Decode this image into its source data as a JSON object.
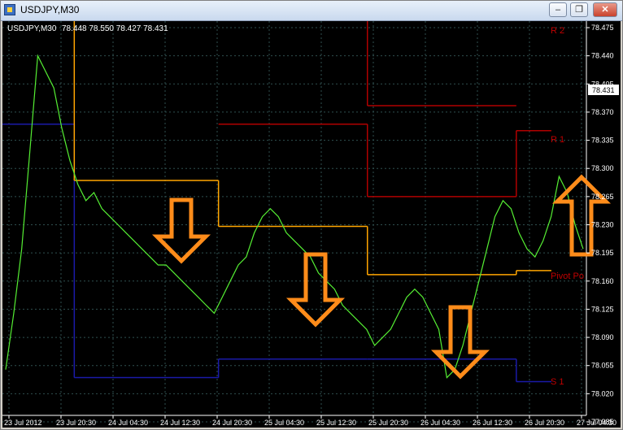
{
  "window": {
    "title": "USDJPY,M30",
    "minimize_label": "–",
    "restore_label": "❐",
    "close_label": "✕"
  },
  "chart_header": {
    "symbol_tf": "USDJPY,M30",
    "ohlc": "78.448 78.550 78.427 78.431"
  },
  "price_labels": [
    "78.475",
    "78.440",
    "78.405",
    "78.370",
    "78.335",
    "78.300",
    "78.265",
    "78.230",
    "78.195",
    "78.160",
    "78.125",
    "78.090",
    "78.055",
    "78.020",
    "77.985"
  ],
  "current_price": "78.431",
  "time_labels": [
    "23 Jul 2012",
    "23 Jul 20:30",
    "24 Jul 04:30",
    "24 Jul 12:30",
    "24 Jul 20:30",
    "25 Jul 04:30",
    "25 Jul 12:30",
    "25 Jul 20:30",
    "26 Jul 04:30",
    "26 Jul 12:30",
    "26 Jul 20:30",
    "27 Jul 04:30"
  ],
  "level_labels": {
    "r2": "R 2",
    "r1": "R 1",
    "pivot": "Pivot Po",
    "s1": "S 1"
  },
  "colors": {
    "background": "#000000",
    "price_line": "#55ee33",
    "pivot": "#ffa500",
    "resistance": "#b00000",
    "support": "#1a1aa8",
    "grid": "#2f4f4f",
    "arrow": "#ff8c1a",
    "axis_text": "#ffffff"
  },
  "arrows": [
    {
      "direction": "down"
    },
    {
      "direction": "down"
    },
    {
      "direction": "down"
    },
    {
      "direction": "up"
    }
  ],
  "chart_data": {
    "type": "line",
    "y_range": [
      77.985,
      78.475
    ],
    "close": [
      78.05,
      78.12,
      78.2,
      78.32,
      78.44,
      78.42,
      78.4,
      78.35,
      78.31,
      78.28,
      78.26,
      78.27,
      78.25,
      78.24,
      78.23,
      78.22,
      78.21,
      78.2,
      78.19,
      78.18,
      78.18,
      78.17,
      78.16,
      78.15,
      78.14,
      78.13,
      78.12,
      78.14,
      78.16,
      78.18,
      78.19,
      78.22,
      78.24,
      78.25,
      78.24,
      78.22,
      78.21,
      78.2,
      78.19,
      78.17,
      78.16,
      78.15,
      78.13,
      78.12,
      78.11,
      78.1,
      78.08,
      78.09,
      78.1,
      78.12,
      78.14,
      78.15,
      78.14,
      78.12,
      78.1,
      78.04,
      78.05,
      78.08,
      78.12,
      78.16,
      78.2,
      78.24,
      78.26,
      78.25,
      78.22,
      78.2,
      78.19,
      78.21,
      78.24,
      78.29,
      78.27,
      78.23,
      78.2
    ],
    "pivot_segments": [
      [
        0,
        0.123,
        78.52
      ],
      [
        0.123,
        0.37,
        78.285
      ],
      [
        0.37,
        0.625,
        78.228
      ],
      [
        0.625,
        0.88,
        78.168
      ],
      [
        0.88,
        0.94,
        78.173
      ]
    ],
    "r1_segments": [
      [
        0.37,
        0.625,
        78.355
      ],
      [
        0.625,
        0.88,
        78.265
      ],
      [
        0.88,
        0.94,
        78.347
      ]
    ],
    "r2_segments": [
      [
        0.37,
        0.625,
        78.5
      ],
      [
        0.625,
        0.88,
        78.378
      ]
    ],
    "s1_segments": [
      [
        0,
        0.123,
        78.355
      ],
      [
        0.123,
        0.37,
        78.04
      ],
      [
        0.37,
        0.625,
        78.063
      ],
      [
        0.625,
        0.88,
        78.063
      ],
      [
        0.88,
        0.94,
        78.035
      ]
    ]
  }
}
